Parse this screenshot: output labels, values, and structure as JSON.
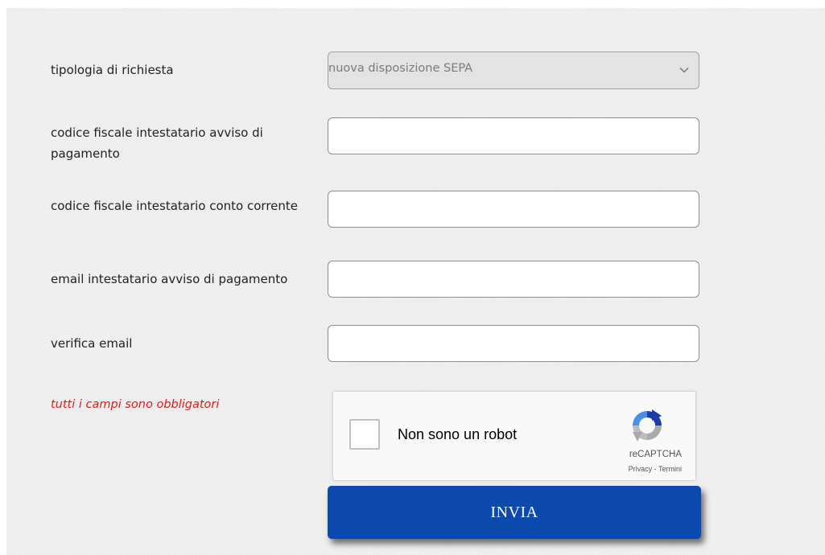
{
  "form": {
    "request_type": {
      "label": "tipologia di richiesta",
      "value": "nuova disposizione SEPA"
    },
    "payer_tax_code": {
      "label": "codice fiscale intestatario avviso di pagamento",
      "value": ""
    },
    "account_holder_tax_code": {
      "label": "codice fiscale intestatario conto corrente",
      "value": ""
    },
    "payer_email": {
      "label": "email intestatario avviso di pagamento",
      "value": ""
    },
    "verify_email": {
      "label": "verifica email",
      "value": ""
    },
    "required_note": "tutti i campi sono obbligatori",
    "submit_label": "INVIA"
  },
  "captcha": {
    "label": "Non sono un robot",
    "brand": "reCAPTCHA",
    "privacy": "Privacy",
    "separator": " - ",
    "terms": "Termini",
    "checked": false
  },
  "colors": {
    "submit_bg": "#0b4aad",
    "required_text": "#e21b1b",
    "panel_bg": "#ececec"
  },
  "icons": {
    "select_arrow": "chevron-down-icon",
    "captcha_logo": "recaptcha-logo-icon"
  }
}
